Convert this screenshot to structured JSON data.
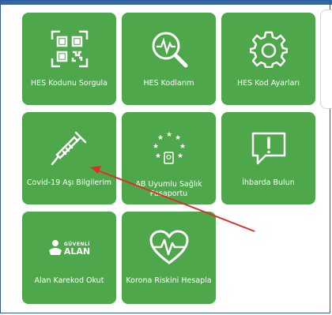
{
  "tiles": [
    {
      "label": "HES Kodunu Sorgula",
      "icon": "qr-code-icon"
    },
    {
      "label": "HES Kodlarım",
      "icon": "search-heartbeat-icon"
    },
    {
      "label": "HES Kod Ayarları",
      "icon": "gear-icon"
    },
    {
      "label": "Covid-19 Aşı Bilgilerim",
      "icon": "syringe-icon"
    },
    {
      "label": "AB Uyumlu Sağlık Pasaportu",
      "icon": "eu-stars-passport-icon"
    },
    {
      "label": "İhbarda Bulun",
      "icon": "report-bubble-icon"
    },
    {
      "label": "Alan Karekod Okut",
      "icon": "safe-area-icon"
    },
    {
      "label": "Korona Riskini Hesapla",
      "icon": "heartbeat-icon"
    }
  ],
  "safe_area_logo": {
    "top": "GÜVENLİ",
    "bottom": "ALAN"
  },
  "colors": {
    "tile": "#4fa74b",
    "annotation_arrow": "#d9302b",
    "frame": "#2f5b9a"
  }
}
